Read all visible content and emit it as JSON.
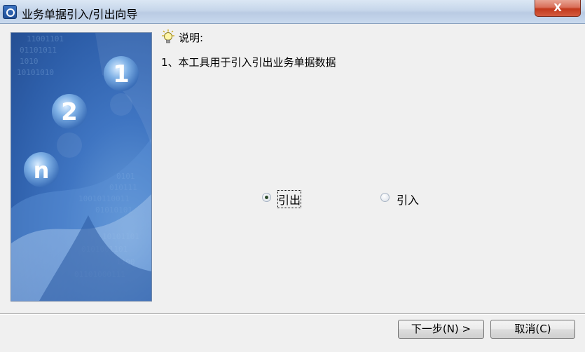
{
  "window": {
    "title": "业务单据引入/引出向导",
    "close_label": "X"
  },
  "banner": {
    "numbers": [
      "1",
      "2",
      "n"
    ],
    "binary_text": [
      "11001101",
      "01101011",
      "1010",
      "10101010",
      "0101",
      "010111",
      "10010110011",
      "01010101",
      "10101101",
      "0101001101",
      "1100",
      "01101000111"
    ]
  },
  "description": {
    "icon": "lightbulb-icon",
    "header": "说明:",
    "line1": "1、本工具用于引入引出业务单据数据"
  },
  "options": {
    "export_label": "引出",
    "import_label": "引入",
    "selected": "export"
  },
  "buttons": {
    "next_label": "下一步(N) >",
    "cancel_label": "取消(C)"
  }
}
